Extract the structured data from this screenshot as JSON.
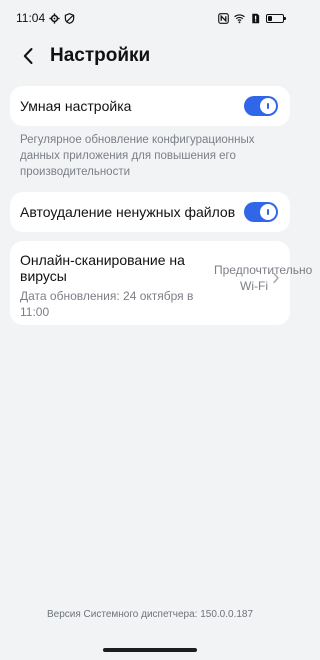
{
  "status_bar": {
    "time": "11:04",
    "battery_level": 0.25
  },
  "header": {
    "title": "Настройки",
    "back_icon": "chevron-left-icon"
  },
  "smart_settings": {
    "label": "Умная настройка",
    "enabled": true
  },
  "smart_description": "Регулярное обновление конфигурационных данных приложения для повышения его производительности",
  "auto_delete": {
    "label": "Автоудаление ненужных файлов",
    "enabled": true
  },
  "virus_scan": {
    "title": "Онлайн-сканирование на вирусы",
    "subtitle": "Дата обновления: 24 октября в 11:00",
    "value": "Предпочтительно Wi-Fi"
  },
  "footer": {
    "version": "Версия Системного диспетчера: 150.0.0.187"
  },
  "colors": {
    "accent": "#2f67e8",
    "background": "#f1f3f5",
    "card": "#ffffff",
    "secondary_text": "#7b7f85"
  }
}
